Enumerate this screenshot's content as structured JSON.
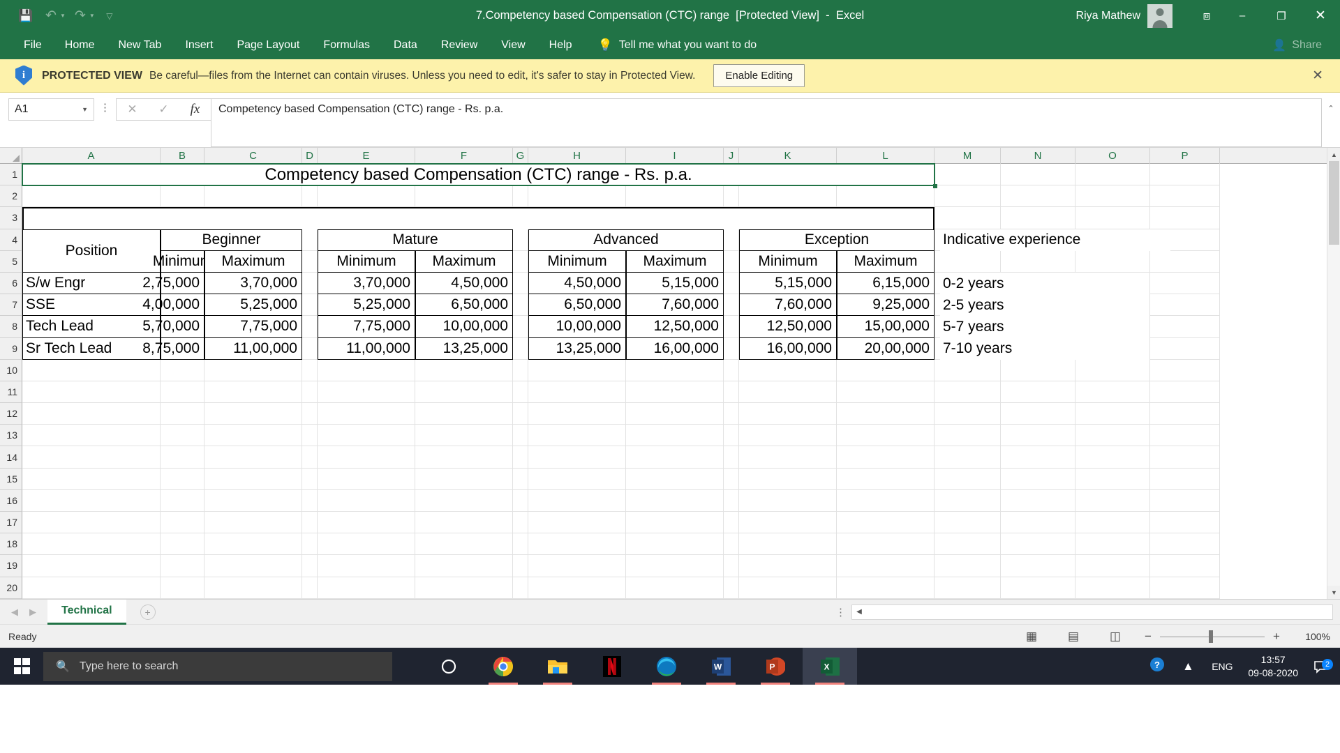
{
  "titlebar": {
    "document_title": "7.Competency based Compensation (CTC) range  [Protected View]  -  Excel",
    "account_name": "Riya Mathew",
    "save_icon": "save-icon",
    "undo_icon": "undo-icon",
    "redo_icon": "redo-icon",
    "customize_qat_icon": "chevron-down-icon",
    "ribbon_display_icon": "ribbon-display-options-icon",
    "minimize_label": "–",
    "maximize_label": "❐",
    "close_label": "✕"
  },
  "menubar": {
    "items": [
      {
        "label": "File"
      },
      {
        "label": "Home"
      },
      {
        "label": "New Tab"
      },
      {
        "label": "Insert"
      },
      {
        "label": "Page Layout"
      },
      {
        "label": "Formulas"
      },
      {
        "label": "Data"
      },
      {
        "label": "Review"
      },
      {
        "label": "View"
      },
      {
        "label": "Help"
      }
    ],
    "tell_me": "Tell me what you want to do",
    "share": "Share"
  },
  "protected_view": {
    "title": "PROTECTED VIEW",
    "message": "Be careful—files from the Internet can contain viruses. Unless you need to edit, it's safer to stay in Protected View.",
    "enable_button": "Enable Editing",
    "close_label": "✕"
  },
  "formula_bar": {
    "name_box_value": "A1",
    "cancel_label": "✕",
    "enter_label": "✓",
    "fx_label": "fx",
    "formula_value": "Competency based Compensation (CTC) range - Rs. p.a.",
    "expand_label": "⌃"
  },
  "grid": {
    "column_headers": [
      "A",
      "B",
      "C",
      "D",
      "E",
      "F",
      "G",
      "H",
      "I",
      "J",
      "K",
      "L",
      "M",
      "N",
      "O",
      "P"
    ],
    "row_headers": [
      "1",
      "2",
      "3",
      "4",
      "5",
      "6",
      "7",
      "8",
      "9",
      "10",
      "11",
      "12",
      "13",
      "14",
      "15",
      "16",
      "17",
      "18",
      "19",
      "20"
    ],
    "selected_cell": "A1",
    "title_cell": "Competency based Compensation (CTC) range - Rs. p.a.",
    "indicative_header": "Indicative experience"
  },
  "chart_data": {
    "type": "table",
    "title": "Competency based Compensation (CTC) range - Rs. p.a.",
    "group_headers": [
      "Beginner",
      "Mature",
      "Advanced",
      "Exception"
    ],
    "sub_headers": [
      "Minimum",
      "Maximum"
    ],
    "position_header": "Position",
    "experience_header": "Indicative experience",
    "rows": [
      {
        "position": "S/w Engr",
        "beginner_min": "2,75,000",
        "beginner_max": "3,70,000",
        "mature_min": "3,70,000",
        "mature_max": "4,50,000",
        "advanced_min": "4,50,000",
        "advanced_max": "5,15,000",
        "exception_min": "5,15,000",
        "exception_max": "6,15,000",
        "experience": "0-2 years"
      },
      {
        "position": "SSE",
        "beginner_min": "4,00,000",
        "beginner_max": "5,25,000",
        "mature_min": "5,25,000",
        "mature_max": "6,50,000",
        "advanced_min": "6,50,000",
        "advanced_max": "7,60,000",
        "exception_min": "7,60,000",
        "exception_max": "9,25,000",
        "experience": "2-5 years"
      },
      {
        "position": "Tech Lead",
        "beginner_min": "5,70,000",
        "beginner_max": "7,75,000",
        "mature_min": "7,75,000",
        "mature_max": "10,00,000",
        "advanced_min": "10,00,000",
        "advanced_max": "12,50,000",
        "exception_min": "12,50,000",
        "exception_max": "15,00,000",
        "experience": "5-7 years"
      },
      {
        "position": "Sr Tech Lead",
        "beginner_min": "8,75,000",
        "beginner_max": "11,00,000",
        "mature_min": "11,00,000",
        "mature_max": "13,25,000",
        "advanced_min": "13,25,000",
        "advanced_max": "16,00,000",
        "exception_min": "16,00,000",
        "exception_max": "20,00,000",
        "experience": "7-10 years"
      }
    ]
  },
  "sheet_tabs": {
    "prev_label": "◀",
    "next_label": "▶",
    "tabs": [
      {
        "label": "Technical"
      }
    ],
    "add_sheet_label": "+"
  },
  "status_bar": {
    "status": "Ready",
    "normal_view_icon": "normal-view-icon",
    "page_layout_icon": "page-layout-view-icon",
    "page_break_icon": "page-break-view-icon",
    "zoom_out_label": "−",
    "zoom_in_label": "+",
    "zoom_value": "100%"
  },
  "taskbar": {
    "search_placeholder": "Type here to search",
    "apps": [
      {
        "name": "cortana-icon",
        "label": "O"
      },
      {
        "name": "chrome-icon",
        "label": ""
      },
      {
        "name": "file-explorer-icon",
        "label": ""
      },
      {
        "name": "netflix-icon",
        "label": "N"
      },
      {
        "name": "edge-icon",
        "label": ""
      },
      {
        "name": "word-icon",
        "label": "W"
      },
      {
        "name": "powerpoint-icon",
        "label": "P"
      },
      {
        "name": "excel-icon",
        "label": "X"
      }
    ],
    "language": "ENG",
    "time": "13:57",
    "date": "09-08-2020",
    "notification_count": "2"
  }
}
